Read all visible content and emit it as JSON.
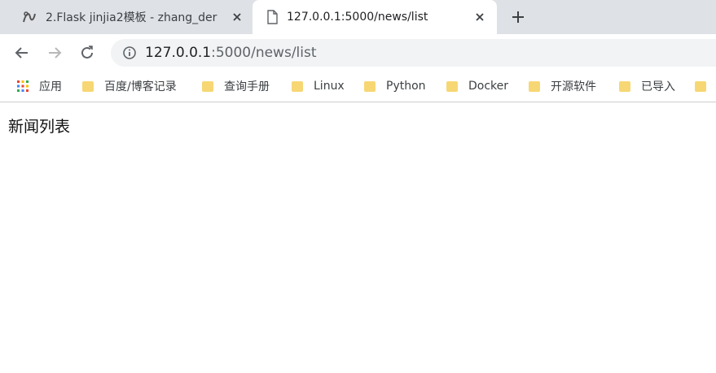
{
  "tabs": [
    {
      "title": "2.Flask jinjia2模板 - zhang_der",
      "icon": "script-logo-icon"
    },
    {
      "title": "127.0.0.1:5000/news/list",
      "icon": "page-icon"
    }
  ],
  "address": {
    "host": "127.0.0.1",
    "path": ":5000/news/list"
  },
  "bookmarks": [
    {
      "label": "应用",
      "icon": "apps-grid-icon"
    },
    {
      "label": "百度/博客记录",
      "icon": "folder-icon"
    },
    {
      "label": "查询手册",
      "icon": "folder-icon"
    },
    {
      "label": "Linux",
      "icon": "folder-icon"
    },
    {
      "label": "Python",
      "icon": "folder-icon"
    },
    {
      "label": "Docker",
      "icon": "folder-icon"
    },
    {
      "label": "开源软件",
      "icon": "folder-icon"
    },
    {
      "label": "已导入",
      "icon": "folder-icon"
    }
  ],
  "page": {
    "heading": "新闻列表"
  },
  "colors": {
    "tabstrip": "#dee1e6",
    "omnibox": "#f1f3f4",
    "folder": "#f7d774"
  }
}
